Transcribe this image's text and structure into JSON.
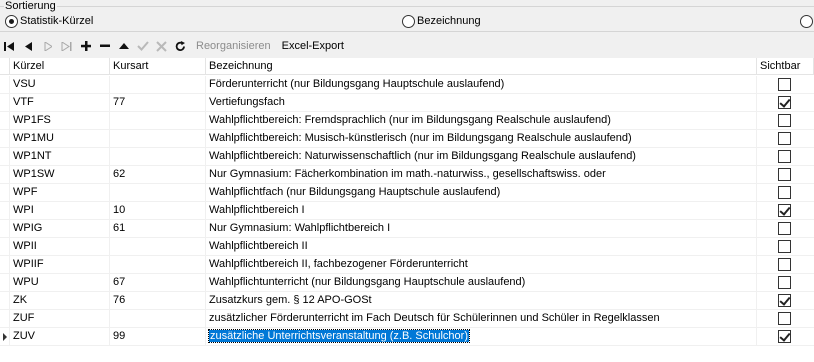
{
  "sort": {
    "legend": "Sortierung",
    "options": [
      {
        "label": "Statistik-Kürzel",
        "checked": true
      },
      {
        "label": "Bezeichnung",
        "checked": false
      },
      {
        "label": "",
        "checked": false
      }
    ]
  },
  "toolbar": {
    "buttons": [
      "first-icon",
      "prev-icon",
      "next-icon",
      "last-icon",
      "add-icon",
      "delete-icon",
      "move-up-icon",
      "confirm-icon",
      "cancel-icon",
      "refresh-icon"
    ],
    "reorg_label": "Reorganisieren",
    "export_label": "Excel-Export"
  },
  "grid": {
    "headers": {
      "kuerzel": "Kürzel",
      "kursart": "Kursart",
      "bezeichnung": "Bezeichnung",
      "sichtbar": "Sichtbar"
    },
    "rows": [
      {
        "kuerzel": "VSU",
        "kursart": "",
        "bezeichnung": "Förderunterricht (nur Bildungsgang Hauptschule auslaufend)",
        "sichtbar": false
      },
      {
        "kuerzel": "VTF",
        "kursart": "77",
        "bezeichnung": "Vertiefungsfach",
        "sichtbar": true
      },
      {
        "kuerzel": "WP1FS",
        "kursart": "",
        "bezeichnung": "Wahlpflichtbereich: Fremdsprachlich (nur im Bildungsgang Realschule auslaufend)",
        "sichtbar": false
      },
      {
        "kuerzel": "WP1MU",
        "kursart": "",
        "bezeichnung": "Wahlpflichtbereich: Musisch-künstlerisch (nur im Bildungsgang Realschule auslaufend)",
        "sichtbar": false
      },
      {
        "kuerzel": "WP1NT",
        "kursart": "",
        "bezeichnung": "Wahlpflichtbereich: Naturwissenschaftlich (nur im Bildungsgang Realschule auslaufend)",
        "sichtbar": false
      },
      {
        "kuerzel": "WP1SW",
        "kursart": "62",
        "bezeichnung": "Nur Gymnasium: Fächerkombination im math.-naturwiss., gesellschaftswiss. oder",
        "sichtbar": false
      },
      {
        "kuerzel": "WPF",
        "kursart": "",
        "bezeichnung": "Wahlpflichtfach (nur Bildungsgang Hauptschule auslaufend)",
        "sichtbar": false
      },
      {
        "kuerzel": "WPI",
        "kursart": "10",
        "bezeichnung": "Wahlpflichtbereich I",
        "sichtbar": true
      },
      {
        "kuerzel": "WPIG",
        "kursart": "61",
        "bezeichnung": "Nur Gymnasium: Wahlpflichtbereich I",
        "sichtbar": false
      },
      {
        "kuerzel": "WPII",
        "kursart": "",
        "bezeichnung": "Wahlpflichtbereich II",
        "sichtbar": false
      },
      {
        "kuerzel": "WPIIF",
        "kursart": "",
        "bezeichnung": "Wahlpflichtbereich II, fachbezogener Förderunterricht",
        "sichtbar": false
      },
      {
        "kuerzel": "WPU",
        "kursart": "67",
        "bezeichnung": "Wahlpflichtunterricht (nur Bildungsgang Hauptschule auslaufend)",
        "sichtbar": false
      },
      {
        "kuerzel": "ZK",
        "kursart": "76",
        "bezeichnung": "Zusatzkurs gem. § 12 APO-GOSt",
        "sichtbar": true
      },
      {
        "kuerzel": "ZUF",
        "kursart": "",
        "bezeichnung": "zusätzlicher Förderunterricht im Fach Deutsch für Schülerinnen und Schüler in Regelklassen",
        "sichtbar": false
      },
      {
        "kuerzel": "ZUV",
        "kursart": "99",
        "bezeichnung": "zusätzliche Unterrichtsveranstaltung (z.B. Schulchor)",
        "sichtbar": true,
        "current": true
      }
    ]
  }
}
